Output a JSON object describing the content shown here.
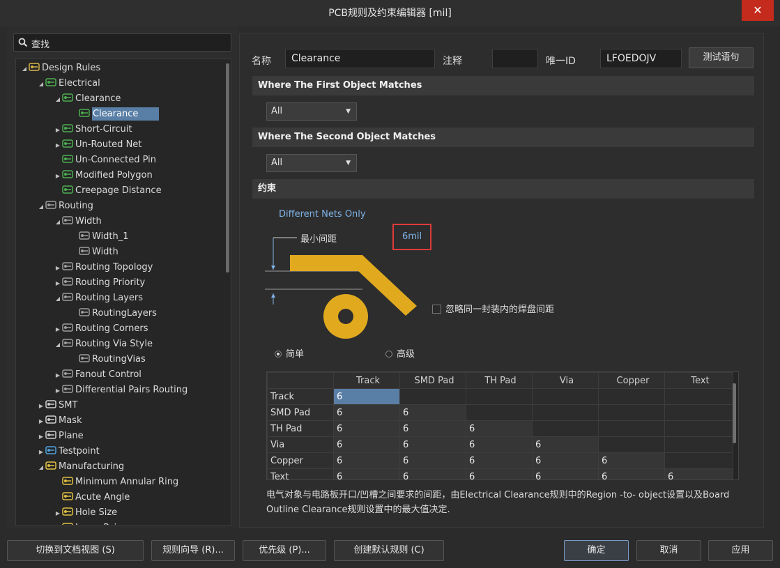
{
  "window": {
    "title": "PCB规则及约束编辑器 [mil]",
    "close": "✕"
  },
  "search": {
    "placeholder": "查找"
  },
  "tree": [
    {
      "label": "Design Rules",
      "level": 0,
      "arrow": "▲",
      "icon": "rules-folder-icon"
    },
    {
      "label": "Electrical",
      "level": 1,
      "arrow": "▲",
      "icon": "electrical-rule-icon"
    },
    {
      "label": "Clearance",
      "level": 2,
      "arrow": "▲",
      "icon": "clearance-rule-icon"
    },
    {
      "label": "Clearance",
      "level": 3,
      "arrow": "",
      "icon": "clearance-rule-icon",
      "selected": true
    },
    {
      "label": "Short-Circuit",
      "level": 2,
      "arrow": "▶",
      "icon": "short-circuit-icon"
    },
    {
      "label": "Un-Routed Net",
      "level": 2,
      "arrow": "▶",
      "icon": "unrouted-net-icon"
    },
    {
      "label": "Un-Connected Pin",
      "level": 2,
      "arrow": "",
      "icon": "unconnected-pin-icon"
    },
    {
      "label": "Modified Polygon",
      "level": 2,
      "arrow": "▶",
      "icon": "modified-polygon-icon"
    },
    {
      "label": "Creepage Distance",
      "level": 2,
      "arrow": "",
      "icon": "creepage-icon"
    },
    {
      "label": "Routing",
      "level": 1,
      "arrow": "▲",
      "icon": "routing-icon"
    },
    {
      "label": "Width",
      "level": 2,
      "arrow": "▲",
      "icon": "width-rule-icon"
    },
    {
      "label": "Width_1",
      "level": 3,
      "arrow": "",
      "icon": "width-rule-icon"
    },
    {
      "label": "Width",
      "level": 3,
      "arrow": "",
      "icon": "width-rule-icon"
    },
    {
      "label": "Routing Topology",
      "level": 2,
      "arrow": "▶",
      "icon": "routing-topology-icon"
    },
    {
      "label": "Routing Priority",
      "level": 2,
      "arrow": "▶",
      "icon": "routing-priority-icon"
    },
    {
      "label": "Routing Layers",
      "level": 2,
      "arrow": "▲",
      "icon": "routing-layers-icon"
    },
    {
      "label": "RoutingLayers",
      "level": 3,
      "arrow": "",
      "icon": "routing-layers-icon"
    },
    {
      "label": "Routing Corners",
      "level": 2,
      "arrow": "▶",
      "icon": "routing-corners-icon"
    },
    {
      "label": "Routing Via Style",
      "level": 2,
      "arrow": "▲",
      "icon": "via-style-icon"
    },
    {
      "label": "RoutingVias",
      "level": 3,
      "arrow": "",
      "icon": "via-style-icon"
    },
    {
      "label": "Fanout Control",
      "level": 2,
      "arrow": "▶",
      "icon": "fanout-icon"
    },
    {
      "label": "Differential Pairs Routing",
      "level": 2,
      "arrow": "▶",
      "icon": "diff-pairs-icon"
    },
    {
      "label": "SMT",
      "level": 1,
      "arrow": "▶",
      "icon": "smt-icon"
    },
    {
      "label": "Mask",
      "level": 1,
      "arrow": "▶",
      "icon": "mask-icon"
    },
    {
      "label": "Plane",
      "level": 1,
      "arrow": "▶",
      "icon": "plane-icon"
    },
    {
      "label": "Testpoint",
      "level": 1,
      "arrow": "▶",
      "icon": "testpoint-icon"
    },
    {
      "label": "Manufacturing",
      "level": 1,
      "arrow": "▲",
      "icon": "manufacturing-icon"
    },
    {
      "label": "Minimum Annular Ring",
      "level": 2,
      "arrow": "",
      "icon": "manufacturing-icon"
    },
    {
      "label": "Acute Angle",
      "level": 2,
      "arrow": "",
      "icon": "manufacturing-icon"
    },
    {
      "label": "Hole Size",
      "level": 2,
      "arrow": "▶",
      "icon": "manufacturing-icon"
    },
    {
      "label": "Layer Pairs",
      "level": 2,
      "arrow": "",
      "icon": "manufacturing-icon"
    }
  ],
  "rule": {
    "name_label": "名称",
    "name_value": "Clearance",
    "comment_label": "注释",
    "comment_value": "",
    "uid_label": "唯一ID",
    "uid_value": "LFOEDOJV",
    "test_button": "测试语句"
  },
  "first_match": {
    "title": "Where The First Object Matches",
    "value": "All"
  },
  "second_match": {
    "title": "Where The Second Object Matches",
    "value": "All"
  },
  "constraints": {
    "title": "约束",
    "net_scope": "Different Nets Only",
    "min_clearance_label": "最小间距",
    "min_clearance_value": "6mil",
    "ignore_pads_label": "忽略同一封装内的焊盘间距",
    "mode_simple": "简单",
    "mode_advanced": "高级"
  },
  "grid": {
    "columns": [
      "",
      "Track",
      "SMD Pad",
      "TH Pad",
      "Via",
      "Copper",
      "Text"
    ],
    "rows": [
      {
        "name": "Track",
        "cells": [
          "6",
          "",
          "",
          "",
          "",
          ""
        ]
      },
      {
        "name": "SMD Pad",
        "cells": [
          "6",
          "6",
          "",
          "",
          "",
          ""
        ]
      },
      {
        "name": "TH Pad",
        "cells": [
          "6",
          "6",
          "6",
          "",
          "",
          ""
        ]
      },
      {
        "name": "Via",
        "cells": [
          "6",
          "6",
          "6",
          "6",
          "",
          ""
        ]
      },
      {
        "name": "Copper",
        "cells": [
          "6",
          "6",
          "6",
          "6",
          "6",
          ""
        ]
      },
      {
        "name": "Text",
        "cells": [
          "6",
          "6",
          "6",
          "6",
          "6",
          "6"
        ]
      }
    ]
  },
  "description": "电气对象与电路板开口/凹槽之间要求的间距，由Electrical Clearance规则中的Region -to- object设置以及Board Outline Clearance规则设置中的最大值决定.",
  "footer": {
    "doc_view": "切换到文档视图 (S)",
    "wizard": "规则向导 (R)...",
    "priority": "优先级 (P)...",
    "default_rules": "创建默认规则 (C)",
    "ok": "确定",
    "cancel": "取消",
    "apply": "应用"
  },
  "colors": {
    "accent": "#5a7fa6",
    "highlight": "#e03a3a",
    "copper": "#e0a91e",
    "link": "#7fb2e8"
  }
}
